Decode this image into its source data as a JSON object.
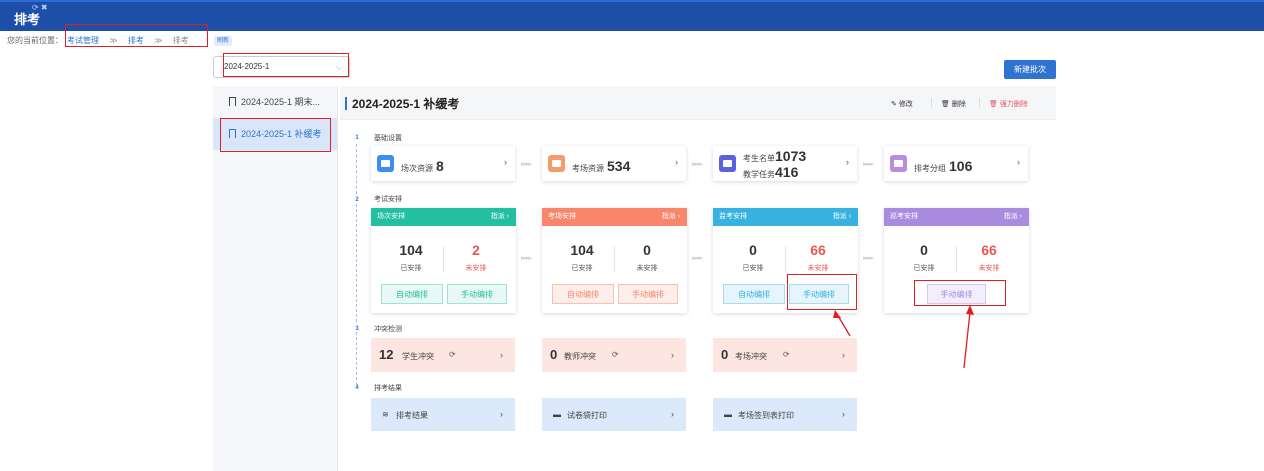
{
  "app": {
    "title": "排考",
    "title_icons": "⟳ ✖"
  },
  "breadcrumb": {
    "prefix": "您的当前位置：",
    "items": [
      "考试管理",
      "排考",
      "排考"
    ],
    "separator": "≫",
    "refresh": "刷新"
  },
  "batch_select": {
    "value": "2024-2025-1",
    "arrow": "⌵"
  },
  "new_batch_button": "新建批次",
  "sidebar": {
    "items": [
      {
        "label": "2024-2025-1 期末..."
      },
      {
        "label": "2024-2025-1 补缓考"
      }
    ]
  },
  "main": {
    "title": "2024-2025-1 补缓考",
    "actions": {
      "edit": "修改",
      "delete": "删除",
      "force_delete": "强力删除"
    },
    "steps": [
      "1",
      "2",
      "3",
      "4"
    ],
    "sections": {
      "basic": "基础设置",
      "arrange": "考试安排",
      "conflict": "冲突检测",
      "result": "排考结果"
    },
    "resources": [
      {
        "label": "场次资源",
        "value": "8",
        "color": "#3e8ef0"
      },
      {
        "label": "考场资源",
        "value": "534",
        "color": "#f59a6a"
      },
      {
        "label": "考生名单",
        "value": "1073",
        "label2": "教学任务",
        "value2": "416",
        "color": "#5a62e0"
      },
      {
        "label": "排考分组",
        "value": "106",
        "color": "#b98ddd"
      }
    ],
    "flow_arrow": "▸▸▸▸",
    "chevron": "›",
    "cards": [
      {
        "title": "场次安排",
        "assign": "指派 ›",
        "color": "#22bfa0",
        "done": "104",
        "done_label": "已安排",
        "todo": "2",
        "todo_label": "未安排",
        "btn_auto": "自动编排",
        "btn_manual": "手动编排"
      },
      {
        "title": "考场安排",
        "assign": "指派 ›",
        "color": "#f7866b",
        "done": "104",
        "done_label": "已安排",
        "todo": "0",
        "todo_label": "未安排",
        "btn_auto": "自动编排",
        "btn_manual": "手动编排"
      },
      {
        "title": "监考安排",
        "assign": "指派 ›",
        "color": "#36b1e0",
        "done": "0",
        "done_label": "已安排",
        "todo": "66",
        "todo_label": "未安排",
        "btn_auto": "自动编排",
        "btn_manual": "手动编排"
      },
      {
        "title": "巡考安排",
        "assign": "指派 ›",
        "color": "#a98be0",
        "done": "0",
        "done_label": "已安排",
        "todo": "66",
        "todo_label": "未安排",
        "btn_manual": "手动编排"
      }
    ],
    "conflicts": [
      {
        "count": "12",
        "label": "学生冲突"
      },
      {
        "count": "0",
        "label": "教师冲突"
      },
      {
        "count": "0",
        "label": "考场冲突"
      }
    ],
    "refresh_glyph": "⟳",
    "results": [
      {
        "icon": "≋",
        "label": "排考结果"
      },
      {
        "icon": "▬",
        "label": "试卷袋打印"
      },
      {
        "icon": "▬",
        "label": "考场签到表打印"
      }
    ]
  }
}
